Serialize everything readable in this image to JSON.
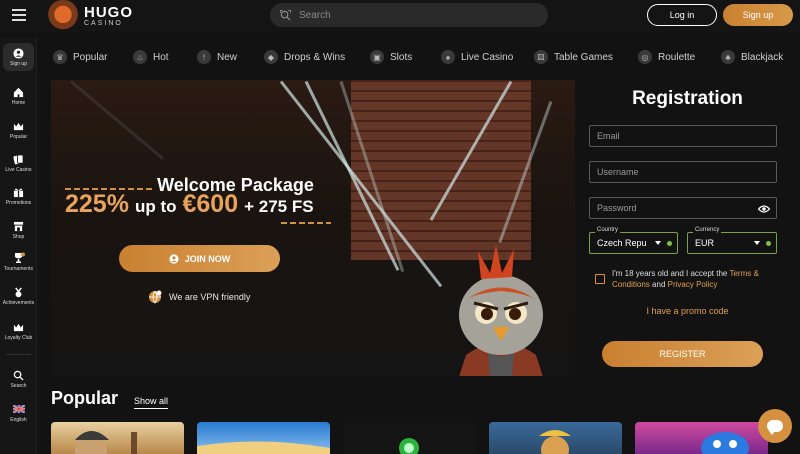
{
  "brand": {
    "name": "HUGO",
    "sub": "CASINO"
  },
  "search": {
    "placeholder": "Search"
  },
  "header": {
    "login_label": "Log in",
    "signup_label": "Sign up"
  },
  "sidebar": {
    "items": [
      {
        "label": "Sign up",
        "icon": "user-icon"
      },
      {
        "label": "Home",
        "icon": "home-icon"
      },
      {
        "label": "Popular",
        "icon": "crown-icon"
      },
      {
        "label": "Live Casino",
        "icon": "cards-icon"
      },
      {
        "label": "Promotions",
        "icon": "gift-icon"
      },
      {
        "label": "Shop",
        "icon": "shop-icon"
      },
      {
        "label": "Tournaments",
        "icon": "trophy-icon"
      },
      {
        "label": "Achievements",
        "icon": "medal-icon"
      },
      {
        "label": "Loyalty Club",
        "icon": "crown-icon"
      },
      {
        "label": "Search",
        "icon": "search-icon"
      },
      {
        "label": "English",
        "icon": "uk-flag-icon"
      }
    ]
  },
  "categories": [
    {
      "label": "Popular",
      "icon": "crown-icon"
    },
    {
      "label": "Hot",
      "icon": "flame-icon"
    },
    {
      "label": "New",
      "icon": "new-icon"
    },
    {
      "label": "Drops & Wins",
      "icon": "drops-icon"
    },
    {
      "label": "Slots",
      "icon": "slot-icon"
    },
    {
      "label": "Live Casino",
      "icon": "cards-icon"
    },
    {
      "label": "Table Games",
      "icon": "dice-icon"
    },
    {
      "label": "Roulette",
      "icon": "roulette-icon"
    },
    {
      "label": "Blackjack",
      "icon": "blackjack-icon"
    }
  ],
  "hero": {
    "title": "Welcome Package",
    "percent": "225%",
    "up_to": "up to",
    "amount": "€600",
    "fs": "+ 275 FS",
    "join_label": "JOIN NOW",
    "vpn_text": "We are VPN friendly"
  },
  "registration": {
    "title": "Registration",
    "email_placeholder": "Email",
    "username_placeholder": "Username",
    "password_placeholder": "Password",
    "country_label": "Country",
    "country_value": "Czech Repu",
    "currency_label": "Currency",
    "currency_value": "EUR",
    "terms_prefix": "I'm 18 years old and I accept the",
    "terms_link": "Terms & Conditions",
    "and": "and",
    "privacy_link": "Privacy Policy",
    "promo_label": "I have a promo code",
    "register_label": "REGISTER"
  },
  "popular": {
    "title": "Popular",
    "show_all": "Show all"
  },
  "colors": {
    "accent": "#d59040",
    "background": "#121212",
    "valid": "#7cc24a"
  }
}
